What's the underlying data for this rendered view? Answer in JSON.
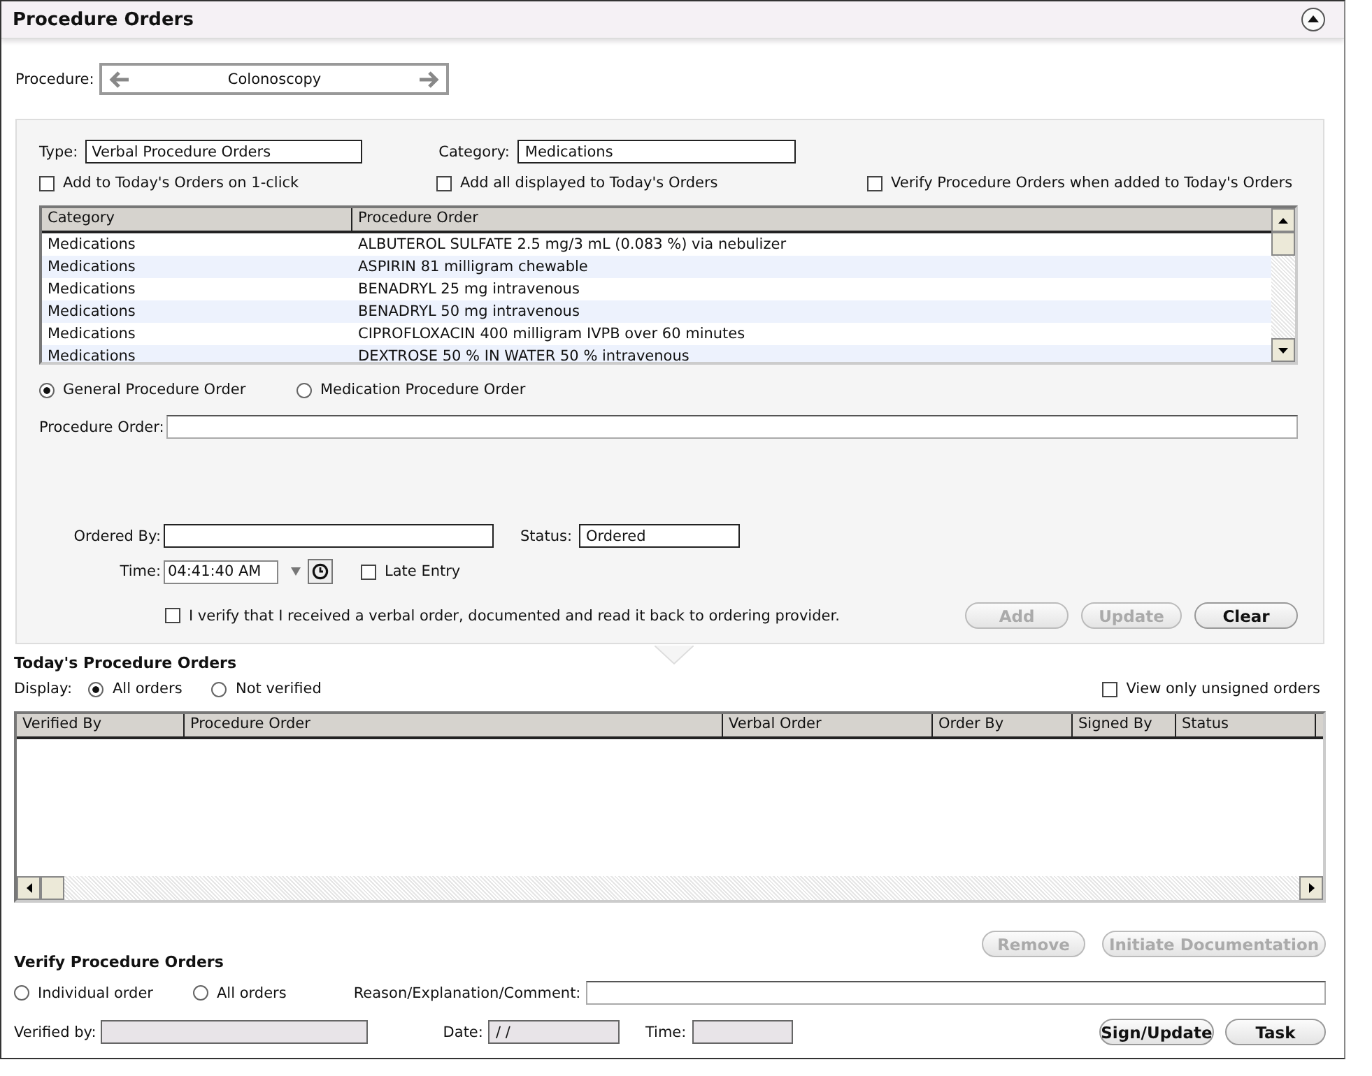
{
  "header": {
    "title": "Procedure Orders"
  },
  "procedure": {
    "label": "Procedure:",
    "value": "Colonoscopy"
  },
  "order_form": {
    "type": {
      "label": "Type:",
      "value": "Verbal Procedure Orders"
    },
    "category": {
      "label": "Category:",
      "value": "Medications"
    },
    "options": [
      {
        "label": "Add to Today's Orders on 1-click",
        "checked": false
      },
      {
        "label": "Add all displayed to Today's Orders",
        "checked": false
      },
      {
        "label": "Verify Procedure Orders when added to Today's Orders",
        "checked": false
      }
    ],
    "list": {
      "columns": [
        "Category",
        "Procedure Order"
      ],
      "rows": [
        [
          "Medications",
          "ALBUTEROL SULFATE 2.5 mg/3 mL (0.083 %) via nebulizer"
        ],
        [
          "Medications",
          "ASPIRIN 81 milligram chewable"
        ],
        [
          "Medications",
          "BENADRYL 25 mg intravenous"
        ],
        [
          "Medications",
          "BENADRYL 50 mg intravenous"
        ],
        [
          "Medications",
          "CIPROFLOXACIN 400 milligram IVPB over 60 minutes"
        ],
        [
          "Medications",
          "DEXTROSE 50 % IN WATER 50 % intravenous"
        ]
      ]
    },
    "order_kind": [
      {
        "label": "General Procedure Order",
        "selected": true
      },
      {
        "label": "Medication Procedure Order",
        "selected": false
      }
    ],
    "procedure_order": {
      "label": "Procedure Order:"
    },
    "ordered_by": {
      "label": "Ordered By:"
    },
    "status": {
      "label": "Status:",
      "value": "Ordered"
    },
    "time": {
      "label": "Time:",
      "value": "04:41:40 AM"
    },
    "late_entry": {
      "label": "Late Entry",
      "checked": false
    },
    "verify": {
      "label": "I verify that I received a verbal order, documented and read it back to ordering provider.",
      "checked": false
    },
    "buttons": [
      {
        "label": "Add",
        "disabled": true
      },
      {
        "label": "Update",
        "disabled": true
      },
      {
        "label": "Clear",
        "disabled": false
      }
    ]
  },
  "todays_orders": {
    "title": "Today's Procedure Orders",
    "display_label": "Display:",
    "display": [
      {
        "label": "All orders",
        "selected": true
      },
      {
        "label": "Not verified",
        "selected": false
      }
    ],
    "unsigned_only": {
      "label": "View only unsigned orders",
      "checked": false
    },
    "table": {
      "columns": [
        "Verified By",
        "Procedure Order",
        "Verbal Order",
        "Order By",
        "Signed By",
        "Status"
      ]
    },
    "buttons": [
      {
        "label": "Remove",
        "disabled": true
      },
      {
        "label": "Initiate Documentation",
        "disabled": true
      }
    ]
  },
  "verify_orders": {
    "title": "Verify Procedure Orders",
    "scope": [
      {
        "label": "Individual order",
        "selected": false
      },
      {
        "label": "All orders",
        "selected": false
      }
    ],
    "reason": {
      "label": "Reason/Explanation/Comment:"
    },
    "verified_by": {
      "label": "Verified by:"
    },
    "date": {
      "label": "Date:",
      "value": "/ /"
    },
    "time": {
      "label": "Time:"
    },
    "buttons": [
      {
        "label": "Sign/Update",
        "disabled": false
      },
      {
        "label": "Task",
        "disabled": false
      }
    ]
  }
}
